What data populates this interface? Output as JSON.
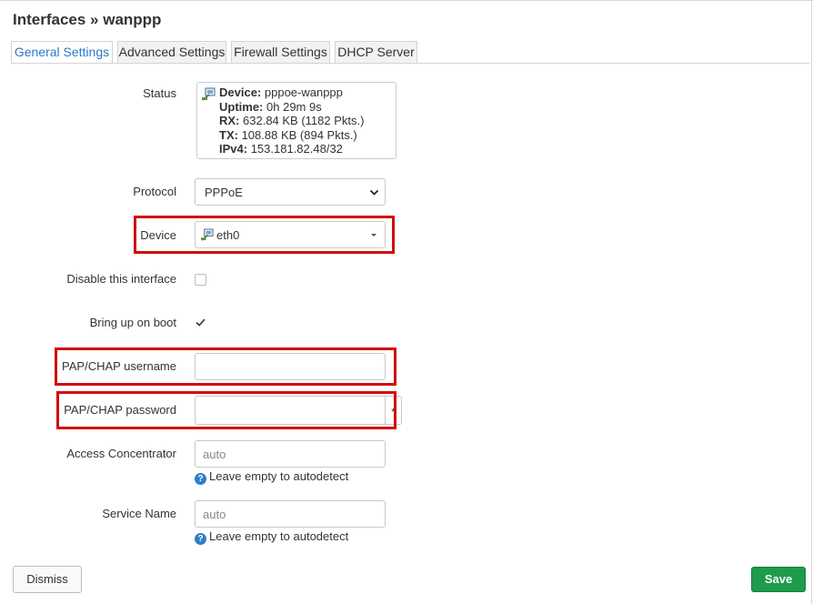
{
  "header": {
    "title": "Interfaces » wanppp"
  },
  "tabs": [
    {
      "label": "General Settings"
    },
    {
      "label": "Advanced Settings"
    },
    {
      "label": "Firewall Settings"
    },
    {
      "label": "DHCP Server"
    }
  ],
  "status": {
    "label": "Status",
    "device_key": "Device:",
    "device_val": "pppoe-wanppp",
    "uptime_key": "Uptime:",
    "uptime_val": "0h 29m 9s",
    "rx_key": "RX:",
    "rx_val": "632.84 KB (1182 Pkts.)",
    "tx_key": "TX:",
    "tx_val": "108.88 KB (894 Pkts.)",
    "ipv4_key": "IPv4:",
    "ipv4_val": "153.181.82.48/32"
  },
  "protocol": {
    "label": "Protocol",
    "value": "PPPoE"
  },
  "device": {
    "label": "Device",
    "value": "eth0"
  },
  "disable_interface": {
    "label": "Disable this interface",
    "checked": false
  },
  "bring_up_on_boot": {
    "label": "Bring up on boot",
    "checked": true
  },
  "username": {
    "label": "PAP/CHAP username",
    "value": ""
  },
  "password": {
    "label": "PAP/CHAP password",
    "value": "",
    "reveal": "*"
  },
  "access_concentrator": {
    "label": "Access Concentrator",
    "placeholder": "auto",
    "help": "Leave empty to autodetect"
  },
  "service_name": {
    "label": "Service Name",
    "placeholder": "auto",
    "help": "Leave empty to autodetect"
  },
  "footer": {
    "dismiss_label": "Dismiss",
    "save_label": "Save"
  },
  "colors": {
    "accent": "#3077c9",
    "save": "#1e9b4b",
    "highlight": "#d40a0a",
    "help_icon": "#2d7fc7"
  },
  "icons": {
    "network_device": "network-device-icon",
    "help": "help-icon",
    "checkmark": "checkmark-icon"
  }
}
